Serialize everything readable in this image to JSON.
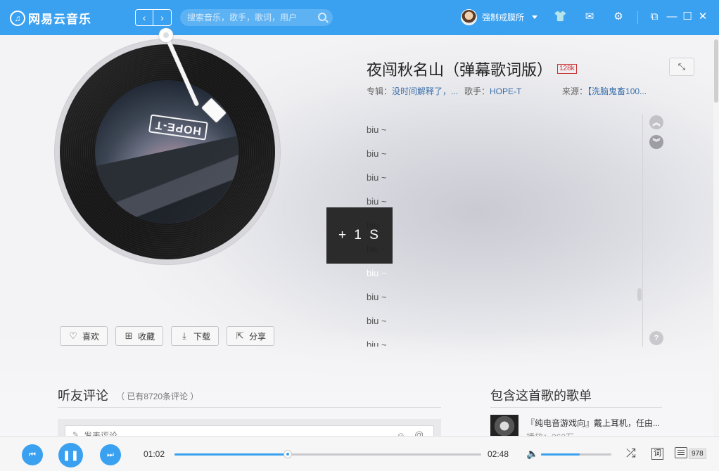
{
  "app": {
    "logo_text": "网易云音乐"
  },
  "search": {
    "placeholder": "搜索音乐，歌手，歌词，用户"
  },
  "user": {
    "name": "强制戒膜所"
  },
  "nav": {
    "back": "‹",
    "forward": "›"
  },
  "song": {
    "title": "夜闯秋名山（弹幕歌词版）",
    "quality": "128k",
    "album_label": "专辑：",
    "album": "没时间解释了，...",
    "artist_label": "歌手：",
    "artist": "HOPE-T",
    "source_label": "来源：",
    "source": "【洗脑鬼畜100..."
  },
  "cover": {
    "logo_text": "HOPE-T"
  },
  "actions": [
    {
      "label": "喜欢",
      "icon": "heart-icon"
    },
    {
      "label": "收藏",
      "icon": "add-folder-icon"
    },
    {
      "label": "下载",
      "icon": "download-icon"
    },
    {
      "label": "分享",
      "icon": "share-icon"
    }
  ],
  "lyrics": {
    "lines": [
      "biu ~",
      "biu ~",
      "biu ~",
      "biu ~",
      "biu ~",
      "biu ~",
      "biu ~",
      "biu ~",
      "biu ~",
      "biu ~"
    ],
    "active_index": 6
  },
  "overlay": {
    "text": "+ 1 S"
  },
  "comments": {
    "title": "听友评论",
    "count": "（ 已有8720条评论 ）",
    "placeholder": "发表评论"
  },
  "playlists": {
    "title": "包含这首歌的歌单",
    "items": [
      {
        "name": "『纯电音游戏向』戴上耳机，任由...",
        "plays": "播放：363万"
      }
    ]
  },
  "player": {
    "current_time": "01:02",
    "total_time": "02:48",
    "progress": 0.369,
    "volume": 0.55,
    "lyric_toggle": "词",
    "playlist_count": "978"
  },
  "colors": {
    "accent": "#3aa0f0",
    "quality_badge": "#cc3333",
    "link": "#3a6ea8"
  }
}
